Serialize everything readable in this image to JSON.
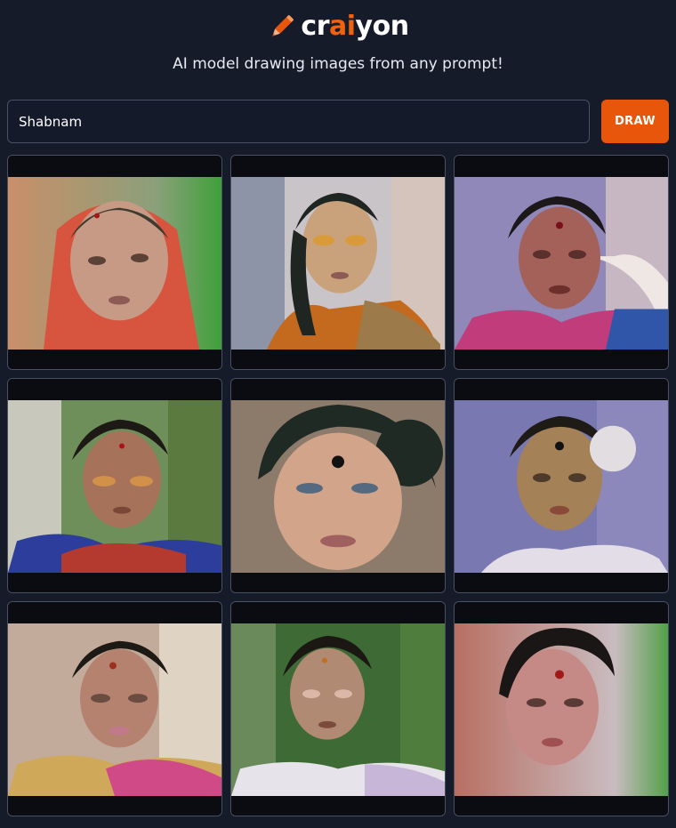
{
  "app": {
    "logo": {
      "part1": "cr",
      "part2": "ai",
      "part3": "yon"
    },
    "tagline": "AI model drawing images from any prompt!",
    "brand_color": "#e8560c"
  },
  "search": {
    "value": "Shabnam",
    "button_label": "DRAW"
  },
  "results": {
    "images": [
      {
        "description": "woman in red saree with veil, green background"
      },
      {
        "description": "woman in orange saree, indoor background"
      },
      {
        "description": "woman with bindi, purple background, blue saree"
      },
      {
        "description": "woman in blue and red saree, green foliage"
      },
      {
        "description": "close-up woman with large bindi"
      },
      {
        "description": "woman with bindi, purple background"
      },
      {
        "description": "woman in yellow and pink saree"
      },
      {
        "description": "woman in white saree, green background"
      },
      {
        "description": "woman with bindi, blurred background"
      }
    ]
  }
}
